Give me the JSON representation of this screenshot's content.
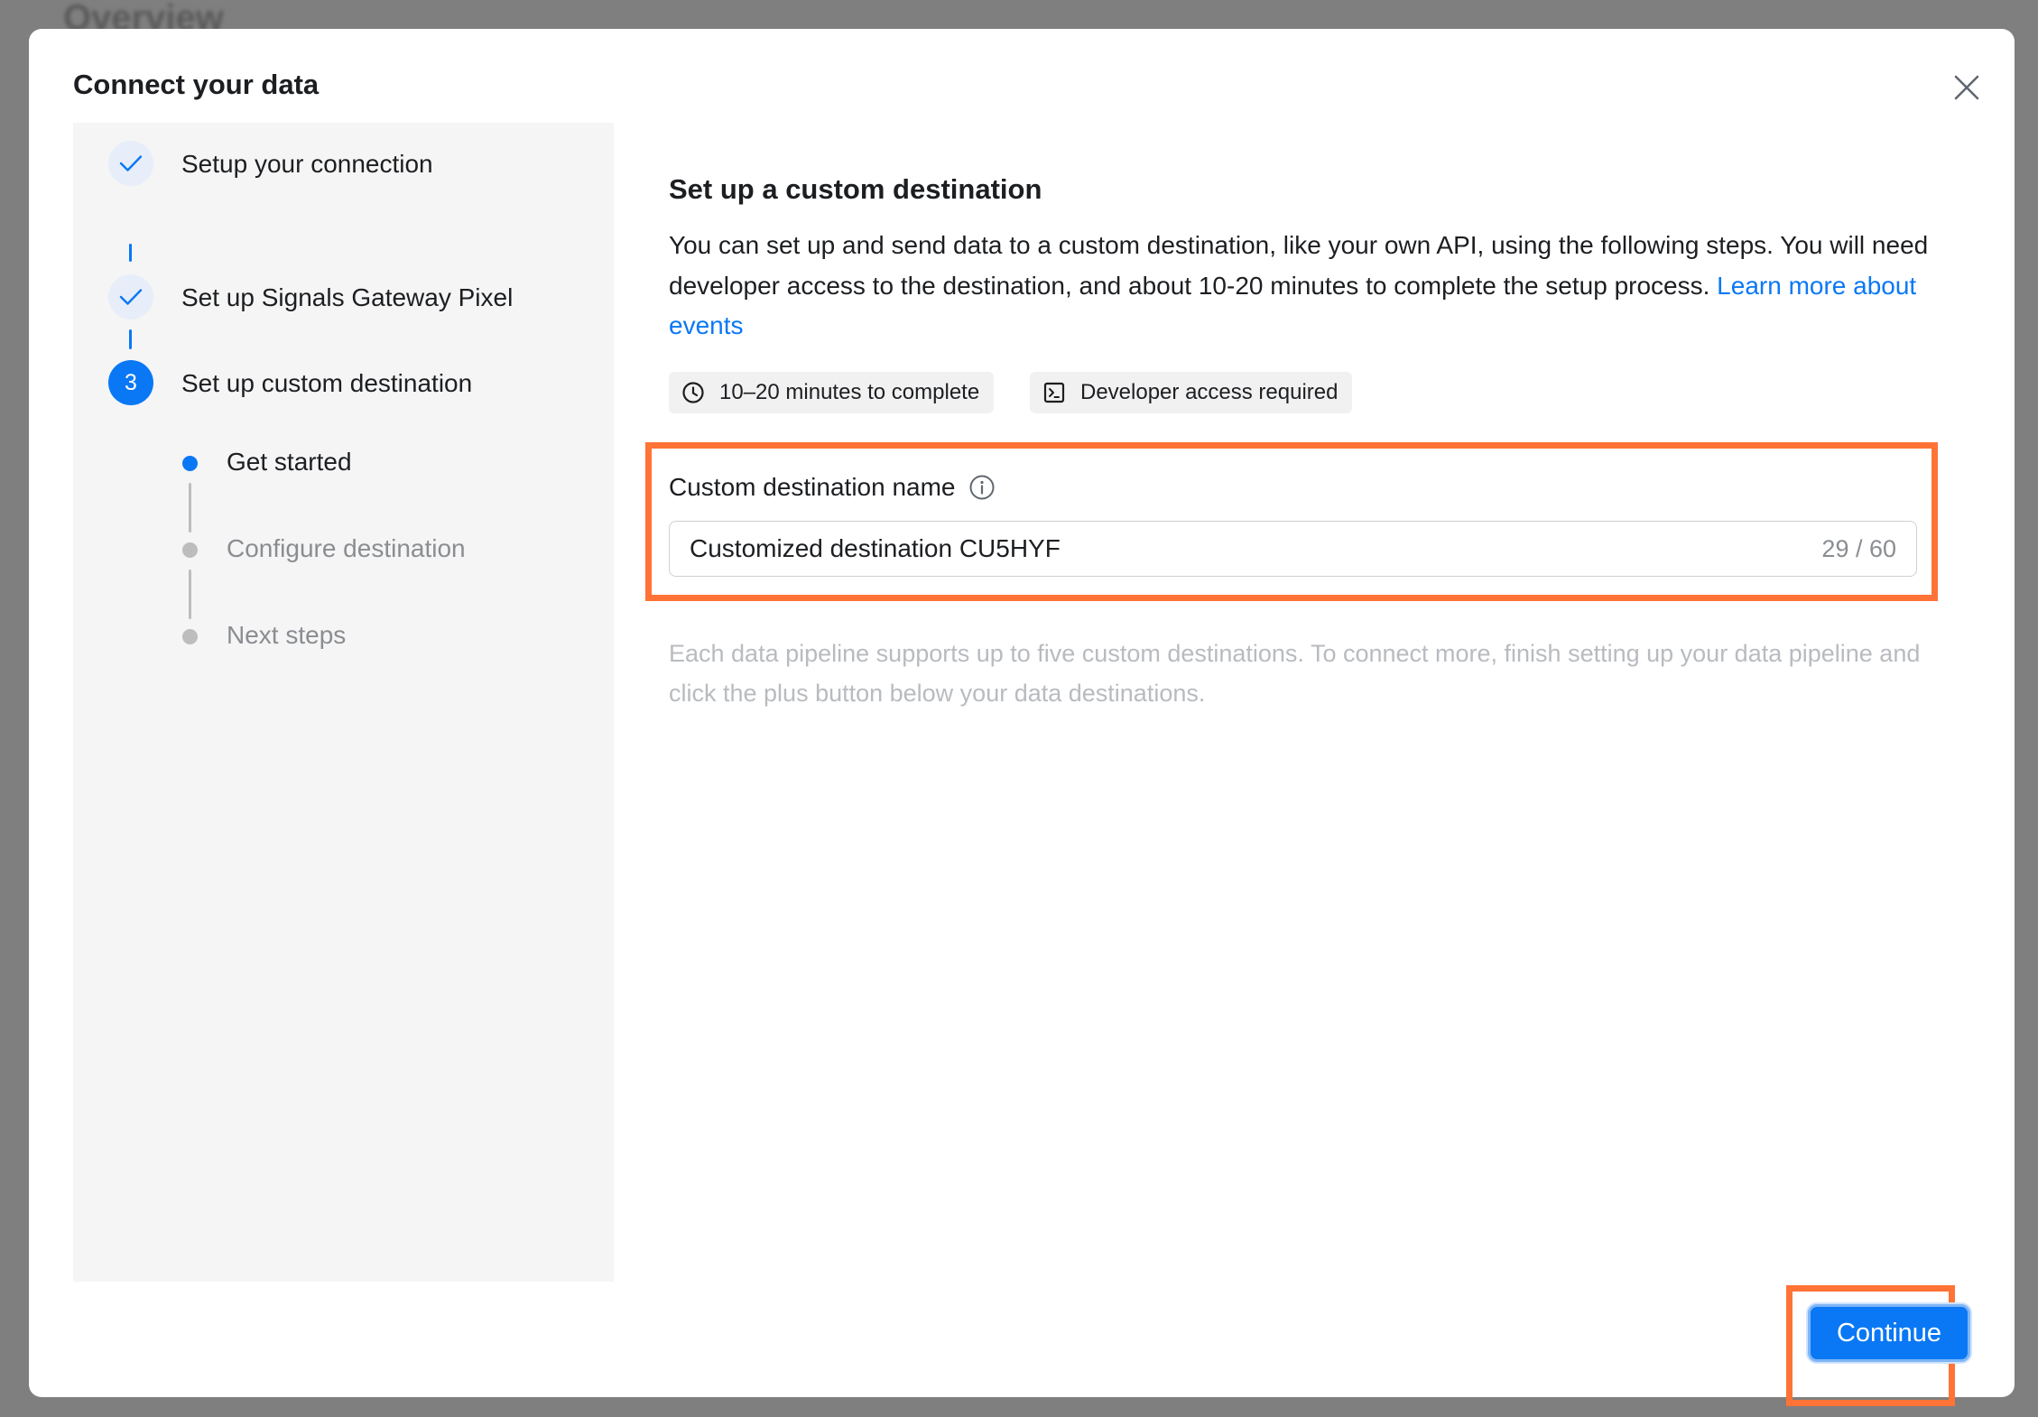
{
  "background": {
    "title": "Overview"
  },
  "modal": {
    "title": "Connect your data",
    "close_icon": "close-icon"
  },
  "steps": [
    {
      "label": "Setup your connection",
      "status": "done"
    },
    {
      "label": "Set up Signals Gateway Pixel",
      "status": "done"
    },
    {
      "label": "Set up custom destination",
      "status": "active",
      "number": "3"
    }
  ],
  "substeps": [
    {
      "label": "Get started",
      "status": "active"
    },
    {
      "label": "Configure destination",
      "status": "pending"
    },
    {
      "label": "Next steps",
      "status": "pending"
    }
  ],
  "content": {
    "title": "Set up a custom destination",
    "description": "You can set up and send data to a custom destination, like your own API, using the following steps. You will need developer access to the destination, and about 10-20 minutes to complete the setup process.",
    "link_text": "Learn more about events",
    "tags": [
      {
        "icon": "clock-icon",
        "label": "10–20 minutes to complete"
      },
      {
        "icon": "terminal-icon",
        "label": "Developer access required"
      }
    ],
    "field": {
      "label": "Custom destination name",
      "info_icon": "info-icon",
      "value": "Customized destination CU5HYF",
      "char_count": "29 / 60"
    },
    "helper_text": "Each data pipeline supports up to five custom destinations. To connect more, finish setting up your data pipeline and click the plus button below your data destinations."
  },
  "footer": {
    "continue_label": "Continue"
  },
  "colors": {
    "accent": "#0a78f5",
    "highlight": "#ff7337",
    "sidebar_bg": "#f5f5f5"
  }
}
